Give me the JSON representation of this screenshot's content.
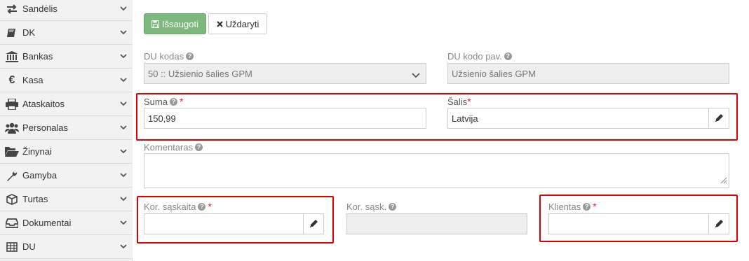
{
  "sidebar": {
    "items": [
      {
        "label": "Sandėlis",
        "icon": "transfer-arrows-icon"
      },
      {
        "label": "DK",
        "icon": "book-icon"
      },
      {
        "label": "Bankas",
        "icon": "bank-icon"
      },
      {
        "label": "Kasa",
        "icon": "euro-icon"
      },
      {
        "label": "Ataskaitos",
        "icon": "print-icon"
      },
      {
        "label": "Personalas",
        "icon": "users-icon"
      },
      {
        "label": "Žinynai",
        "icon": "folder-open-icon"
      },
      {
        "label": "Gamyba",
        "icon": "wrench-icon"
      },
      {
        "label": "Turtas",
        "icon": "cube-icon"
      },
      {
        "label": "Dokumentai",
        "icon": "inbox-icon"
      },
      {
        "label": "DU",
        "icon": "table-icon"
      }
    ]
  },
  "toolbar": {
    "save_label": "Išsaugoti",
    "close_label": "Uždaryti"
  },
  "form": {
    "du_kodas": {
      "label": "DU kodas",
      "value": "50 :: Užsienio šalies GPM"
    },
    "du_kodo_pav": {
      "label": "DU kodo pav.",
      "value": "Užsienio šalies GPM"
    },
    "suma": {
      "label": "Suma",
      "required_mark": "*",
      "value": "150,99"
    },
    "salis": {
      "label": "Šalis",
      "required_mark": "*",
      "value": "Latvija"
    },
    "komentaras": {
      "label": "Komentaras",
      "value": ""
    },
    "kor_saskaita": {
      "label": "Kor. sąskaita",
      "required_mark": "*",
      "value": ""
    },
    "kor_sask": {
      "label": "Kor. sąsk.",
      "value": ""
    },
    "klientas": {
      "label": "Klientas",
      "required_mark": "*",
      "value": ""
    }
  },
  "colors": {
    "save_button": "#7cb87c",
    "highlight": "#e00000",
    "required": "#d9232d",
    "sidebar_bg": "#f2f2f2"
  }
}
